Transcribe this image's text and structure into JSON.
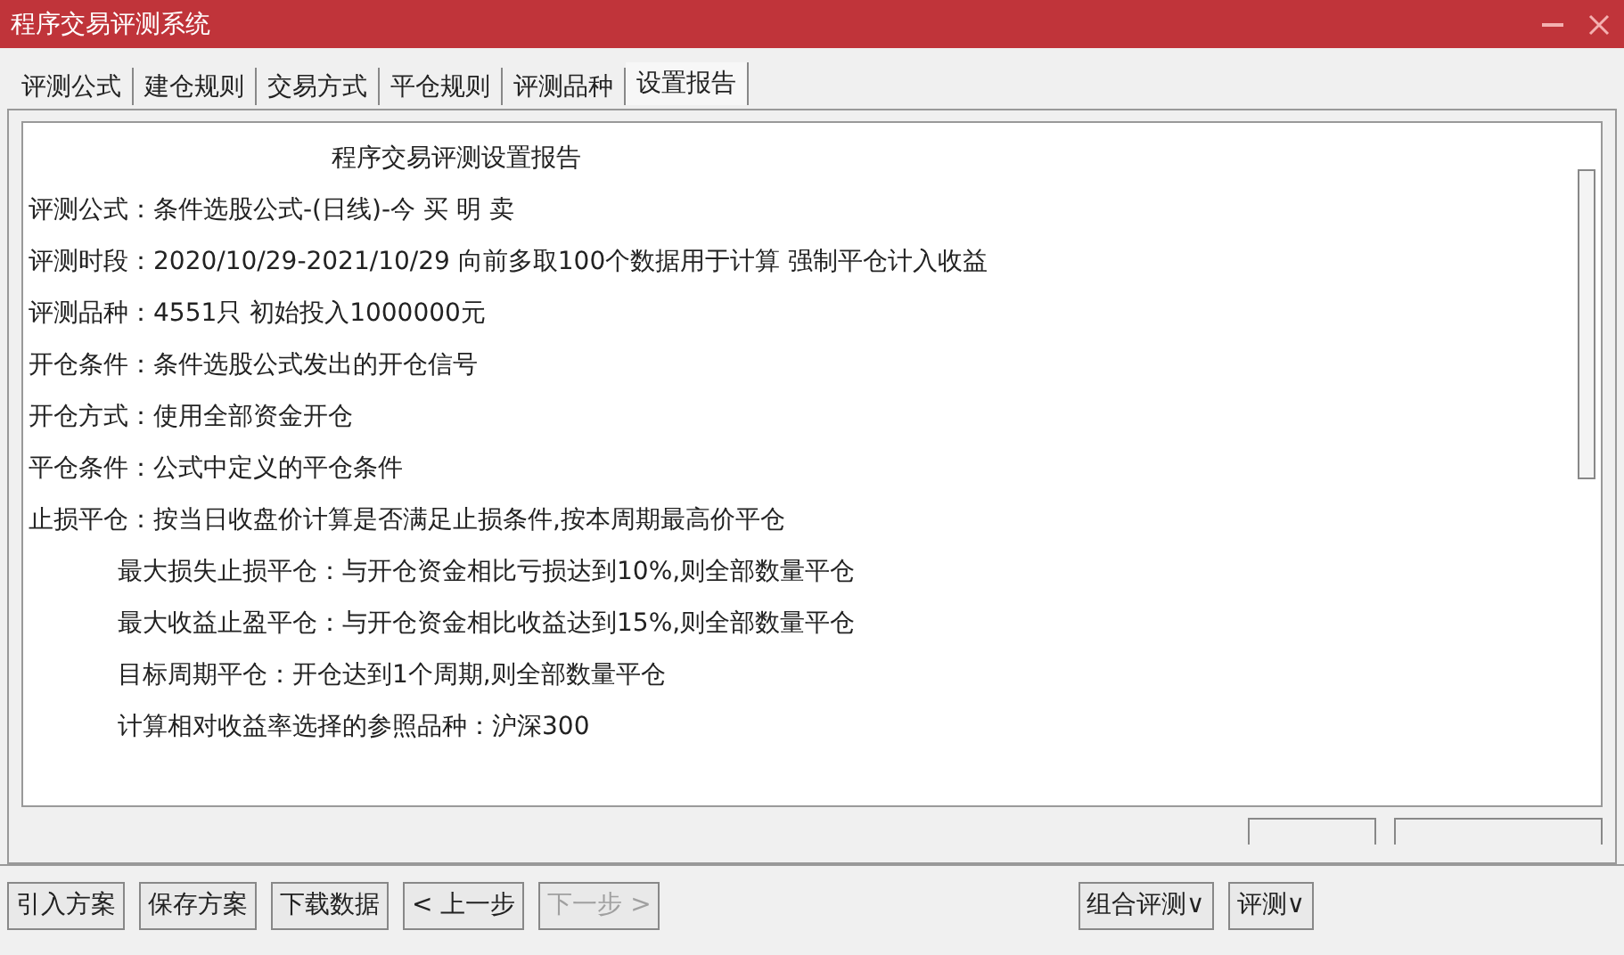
{
  "window": {
    "title": "程序交易评测系统"
  },
  "tabs": [
    {
      "label": "评测公式",
      "selected": false
    },
    {
      "label": "建仓规则",
      "selected": false
    },
    {
      "label": "交易方式",
      "selected": false
    },
    {
      "label": "平仓规则",
      "selected": false
    },
    {
      "label": "评测品种",
      "selected": false
    },
    {
      "label": "设置报告",
      "selected": true
    }
  ],
  "report": [
    {
      "kind": "heading",
      "text": "程序交易评测设置报告"
    },
    {
      "kind": "line",
      "text": "评测公式：条件选股公式-(日线)-今 买 明 卖"
    },
    {
      "kind": "line",
      "text": "评测时段：2020/10/29-2021/10/29 向前多取100个数据用于计算 强制平仓计入收益"
    },
    {
      "kind": "line",
      "text": "评测品种：4551只 初始投入1000000元"
    },
    {
      "kind": "line",
      "text": "开仓条件：条件选股公式发出的开仓信号"
    },
    {
      "kind": "line",
      "text": "开仓方式：使用全部资金开仓"
    },
    {
      "kind": "line",
      "text": "平仓条件：公式中定义的平仓条件"
    },
    {
      "kind": "line",
      "text": "止损平仓：按当日收盘价计算是否满足止损条件,按本周期最高价平仓"
    },
    {
      "kind": "subline",
      "text": "最大损失止损平仓：与开仓资金相比亏损达到10%,则全部数量平仓"
    },
    {
      "kind": "subline",
      "text": "最大收益止盈平仓：与开仓资金相比收益达到15%,则全部数量平仓"
    },
    {
      "kind": "subline",
      "text": "目标周期平仓：开仓达到1个周期,则全部数量平仓"
    },
    {
      "kind": "subline",
      "text": "计算相对收益率选择的参照品种：沪深300"
    }
  ],
  "buttons_left": [
    {
      "label": "引入方案",
      "disabled": false
    },
    {
      "label": "保存方案",
      "disabled": false
    },
    {
      "label": "下载数据",
      "disabled": false
    },
    {
      "label": "< 上一步",
      "disabled": false
    },
    {
      "label": "下一步 >",
      "disabled": true
    }
  ],
  "buttons_right": [
    {
      "label": "组合评测∨"
    },
    {
      "label": "评测∨"
    }
  ]
}
